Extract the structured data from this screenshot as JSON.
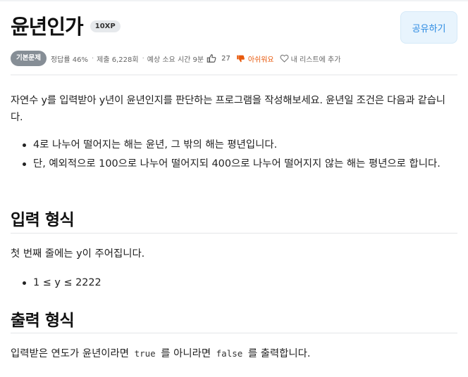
{
  "problem": {
    "title": "윤년인가",
    "xp": "10XP",
    "share_label": "공유하기"
  },
  "meta": {
    "level": "기본문제",
    "accuracy": "정답률 46%",
    "submissions": "제출 6,228회",
    "time": "예상 소요 시간 9분",
    "likes": "27",
    "dislike_label": "아쉬워요",
    "wishlist_label": "내 리스트에 추가"
  },
  "description": {
    "intro": "자연수 y를 입력받아 y년이 윤년인지를 판단하는 프로그램을 작성해보세요. 윤년일 조건은 다음과 같습니다.",
    "rules": [
      "4로 나누어 떨어지는 해는 윤년, 그 밖의 해는 평년입니다.",
      "단, 예외적으로 100으로 나누어 떨어지되 400으로 나누어 떨어지지 않는 해는 평년으로 합니다."
    ]
  },
  "input_section": {
    "heading": "입력 형식",
    "text": "첫 번째 줄에는 y이 주어집니다.",
    "constraint": "1 ≤ y ≤ 2222"
  },
  "output_section": {
    "heading": "출력 형식",
    "prefix": "입력받은 연도가 윤년이라면",
    "true_code": "true",
    "middle": "를 아니라면",
    "false_code": "false",
    "suffix": "를 출력합니다."
  },
  "icons": {
    "like": "thumbs-up-icon",
    "dislike": "thumbs-down-icon",
    "wishlist": "heart-icon"
  },
  "colors": {
    "accent_blue": "#2b8ae2",
    "dislike_orange": "#e8590c",
    "level_badge": "#868e96"
  }
}
